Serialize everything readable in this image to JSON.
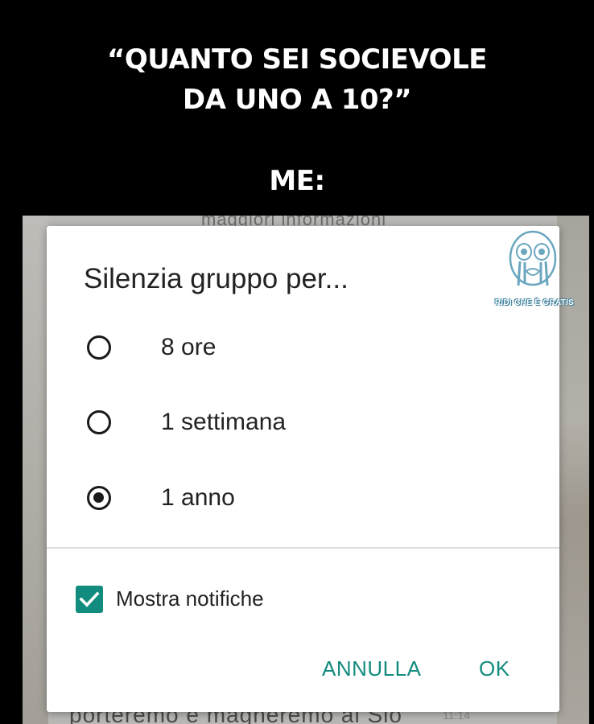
{
  "caption": {
    "line1": "“QUANTO SEI SOCIEVOLE",
    "line2": "DA UNO A 10?”",
    "me": "ME:"
  },
  "background": {
    "top_text": "maggiori informazioni",
    "bottom_text": "porteremo e magneremo al Sio",
    "time": "11:14"
  },
  "dialog": {
    "title": "Silenzia gruppo per...",
    "options": [
      {
        "label": "8 ore",
        "selected": false
      },
      {
        "label": "1 settimana",
        "selected": false
      },
      {
        "label": "1 anno",
        "selected": true
      }
    ],
    "checkbox": {
      "label": "Mostra notifiche",
      "checked": true
    },
    "buttons": {
      "cancel": "ANNULLA",
      "ok": "OK"
    },
    "accent_color": "#128c7e"
  },
  "watermark": {
    "text": "RIDI CHE È GRATIS",
    "icon": "crying-face-icon"
  }
}
